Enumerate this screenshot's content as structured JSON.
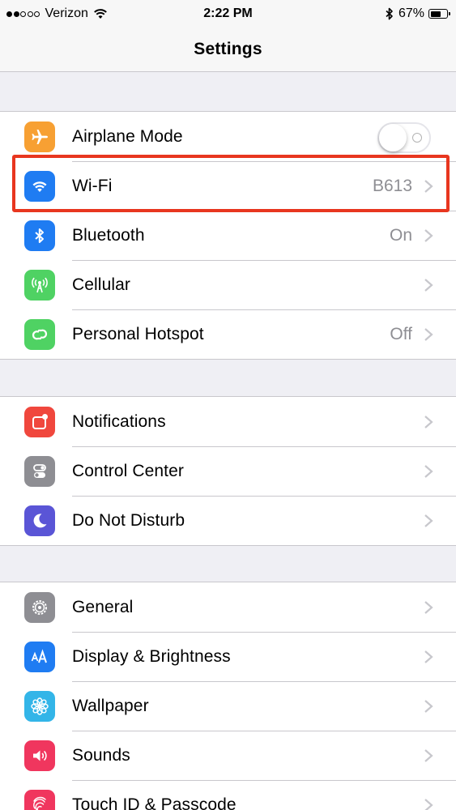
{
  "status_bar": {
    "carrier": "Verizon",
    "time": "2:22 PM",
    "battery": "67%",
    "battery_level": 0.67,
    "signal_bars_filled": 2,
    "signal_bars_total": 5
  },
  "nav": {
    "title": "Settings"
  },
  "groups": [
    {
      "items": [
        {
          "label": "Airplane Mode",
          "value": "",
          "icon": "airplane-icon",
          "color": "#f7a033",
          "control": "toggle",
          "toggle_on": false
        },
        {
          "label": "Wi-Fi",
          "value": "B613",
          "icon": "wifi-icon",
          "color": "#1f7cf2",
          "control": "chevron",
          "highlighted": true
        },
        {
          "label": "Bluetooth",
          "value": "On",
          "icon": "bluetooth-icon",
          "color": "#1f7cf2",
          "control": "chevron"
        },
        {
          "label": "Cellular",
          "value": "",
          "icon": "cellular-antenna-icon",
          "color": "#4fd263",
          "control": "chevron"
        },
        {
          "label": "Personal Hotspot",
          "value": "Off",
          "icon": "hotspot-link-icon",
          "color": "#4fd263",
          "control": "chevron"
        }
      ]
    },
    {
      "items": [
        {
          "label": "Notifications",
          "value": "",
          "icon": "notifications-icon",
          "color": "#f0473d",
          "control": "chevron"
        },
        {
          "label": "Control Center",
          "value": "",
          "icon": "control-center-icon",
          "color": "#8e8e93",
          "control": "chevron"
        },
        {
          "label": "Do Not Disturb",
          "value": "",
          "icon": "moon-icon",
          "color": "#5a55d6",
          "control": "chevron"
        }
      ]
    },
    {
      "items": [
        {
          "label": "General",
          "value": "",
          "icon": "gear-icon",
          "color": "#8e8e93",
          "control": "chevron"
        },
        {
          "label": "Display & Brightness",
          "value": "",
          "icon": "display-aa-icon",
          "color": "#1f7cf2",
          "control": "chevron"
        },
        {
          "label": "Wallpaper",
          "value": "",
          "icon": "wallpaper-flower-icon",
          "color": "#33b5e8",
          "control": "chevron"
        },
        {
          "label": "Sounds",
          "value": "",
          "icon": "speaker-icon",
          "color": "#f0365e",
          "control": "chevron"
        },
        {
          "label": "Touch ID & Passcode",
          "value": "",
          "icon": "fingerprint-icon",
          "color": "#f0365e",
          "control": "chevron"
        }
      ]
    }
  ]
}
